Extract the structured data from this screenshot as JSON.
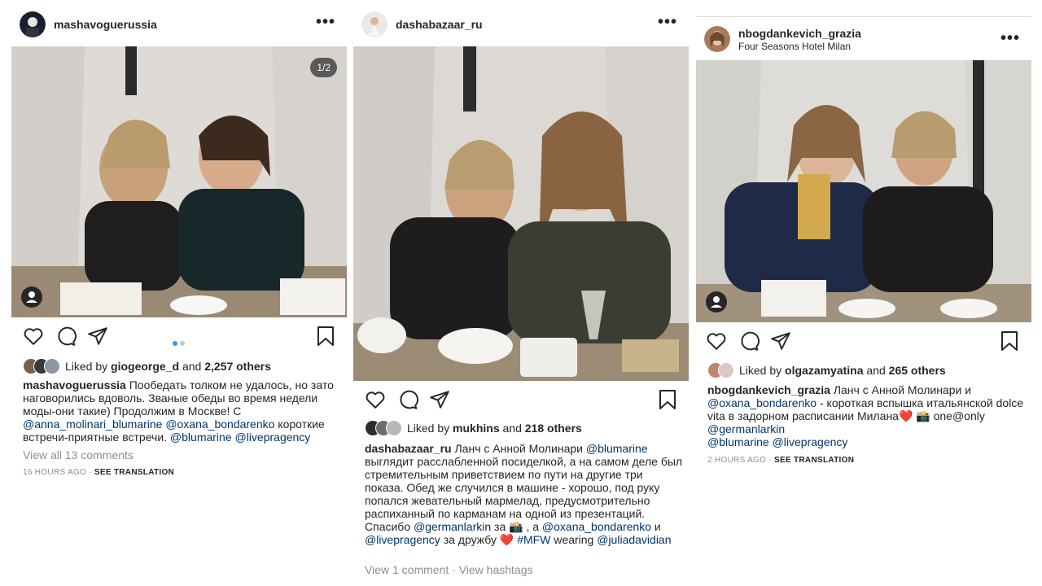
{
  "posts": [
    {
      "username": "mashavoguerussia",
      "counter": "1/2",
      "liked_prefix": "Liked by",
      "liked_by": "giogeorge_d",
      "and": "and",
      "others": "2,257 others",
      "caption_user": "mashavoguerussia",
      "caption_text_1": " Пообедать толком не удалось, но зато наговорились вдоволь. Званые обеды во время недели моды-они такие) Продолжим в Москве! С ",
      "mention_1": "@anna_molinari_blumarine",
      "sp1": " ",
      "mention_2": "@oxana_bondarenko",
      "caption_text_2": " короткие встречи-приятные встречи. ",
      "mention_3": "@blumarine",
      "sp2": " ",
      "mention_4": "@livepragency",
      "view_comments": "View all 13 comments",
      "time": "16 HOURS AGO",
      "sep": " · ",
      "translate": "SEE TRANSLATION"
    },
    {
      "username": "dashabazaar_ru",
      "liked_prefix": "Liked by",
      "liked_by": "mukhins",
      "and": "and",
      "others": "218 others",
      "caption_user": "dashabazaar_ru",
      "caption_text_1": " Ланч с Анной Молинари ",
      "mention_1": "@blumarine",
      "caption_text_2": " выглядит расслабленной посиделкой, а на самом деле был стремительным приветствием по пути на другие три показа. Обед же случился в машине - хорошо, под руку попался жевательный мармелад, предусмотрительно распиханный по карманам на одной из презентаций. Спасибо ",
      "mention_2": "@germanlarkin",
      "caption_text_3": " за 📸 , а ",
      "mention_3": "@oxana_bondarenko",
      "caption_text_4": " и ",
      "mention_4": "@livepragency",
      "caption_text_5": " за дружбу ❤️ ",
      "mention_5": "#MFW",
      "caption_text_6": " wearing ",
      "mention_6": "@juliadavidian",
      "view_comments": "View 1 comment",
      "sep": " · ",
      "view_hashtags": "View hashtags"
    },
    {
      "username": "nbogdankevich_grazia",
      "location": "Four Seasons Hotel Milan",
      "liked_prefix": "Liked by",
      "liked_by": "olgazamyatina",
      "and": "and",
      "others": "265 others",
      "caption_user": "nbogdankevich_grazia",
      "caption_text_1": " Ланч с Анной Молинари и ",
      "mention_1": "@oxana_bondarenko",
      "caption_text_2": " - короткая вспышка итальянской dolce vita в задорном расписании Милана❤️ 📸 one@only ",
      "mention_2": "@germanlarkin",
      "mention_3": "@blumarine",
      "sp1": " ",
      "mention_4": "@livepragency",
      "time": "2 HOURS AGO",
      "sep": " · ",
      "translate": "SEE TRANSLATION"
    }
  ],
  "colors": {
    "link": "#003569",
    "muted": "#8e8e8e",
    "carousel_active": "#3897f0"
  },
  "icons": [
    "more-icon",
    "heart-icon",
    "comment-icon",
    "share-icon",
    "bookmark-icon",
    "user-tag-icon"
  ]
}
